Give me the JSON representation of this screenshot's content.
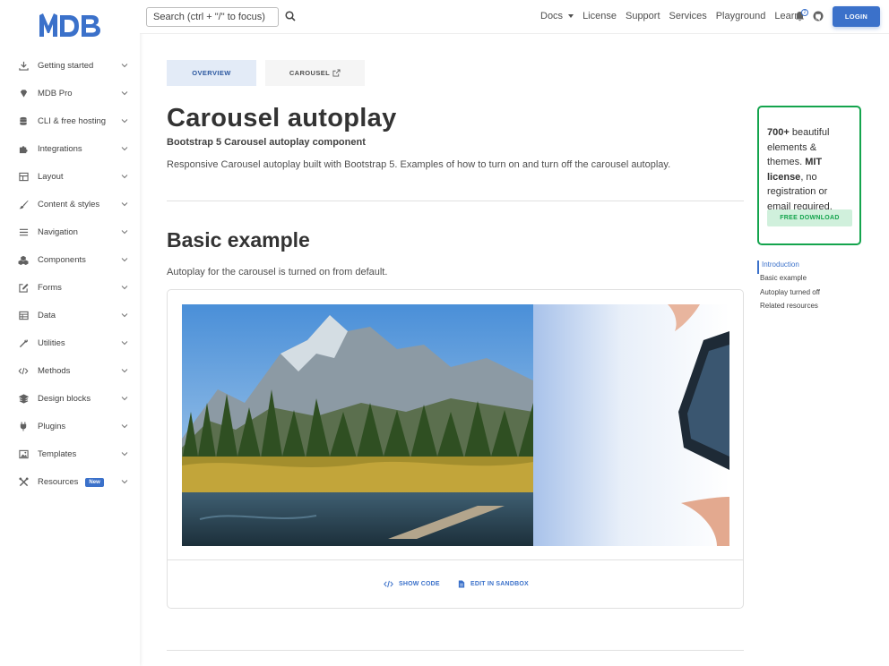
{
  "logo": {
    "text": "MDB",
    "color": "#3b71ca"
  },
  "sidebar": {
    "items": [
      {
        "label": "Getting started",
        "icon": "download-icon"
      },
      {
        "label": "MDB Pro",
        "icon": "gem-icon"
      },
      {
        "label": "CLI & free hosting",
        "icon": "database-icon"
      },
      {
        "label": "Integrations",
        "icon": "puzzle-icon"
      },
      {
        "label": "Layout",
        "icon": "table-layout-icon"
      },
      {
        "label": "Content & styles",
        "icon": "brush-icon"
      },
      {
        "label": "Navigation",
        "icon": "list-icon"
      },
      {
        "label": "Components",
        "icon": "cubes-icon"
      },
      {
        "label": "Forms",
        "icon": "edit-icon"
      },
      {
        "label": "Data",
        "icon": "table-icon"
      },
      {
        "label": "Utilities",
        "icon": "wrench-icon"
      },
      {
        "label": "Methods",
        "icon": "code-icon"
      },
      {
        "label": "Design blocks",
        "icon": "layer-group-icon"
      },
      {
        "label": "Plugins",
        "icon": "plug-icon"
      },
      {
        "label": "Templates",
        "icon": "image-icon"
      },
      {
        "label": "Resources",
        "icon": "tools-icon",
        "badge": "New"
      }
    ]
  },
  "navbar": {
    "search_placeholder": "Search (ctrl + \"/\" to focus)",
    "links": [
      "Docs",
      "License",
      "Support",
      "Services",
      "Playground",
      "Learn"
    ],
    "notification_count": "2",
    "login_label": "LOGIN"
  },
  "tabs": {
    "overview": "OVERVIEW",
    "carousel": "CAROUSEL"
  },
  "main": {
    "title": "Carousel autoplay",
    "subtitle": "Bootstrap 5 Carousel autoplay component",
    "description": "Responsive Carousel autoplay built with Bootstrap 5. Examples of how to turn on and turn off the carousel autoplay.",
    "section_title": "Basic example",
    "section_description": "Autoplay for the carousel is turned on from default.",
    "show_code": "SHOW CODE",
    "edit_sandbox": "EDIT IN SANDBOX"
  },
  "promo": {
    "count": "700+",
    "text1": " beautiful elements & themes.",
    "license": "MIT license",
    "text2": ", no registration or email required.",
    "button": "FREE DOWNLOAD",
    "accent": "#14a44d"
  },
  "toc": {
    "items": [
      "Introduction",
      "Basic example",
      "Autoplay turned off",
      "Related resources"
    ]
  },
  "colors": {
    "primary": "#3b71ca",
    "success": "#14a44d"
  }
}
